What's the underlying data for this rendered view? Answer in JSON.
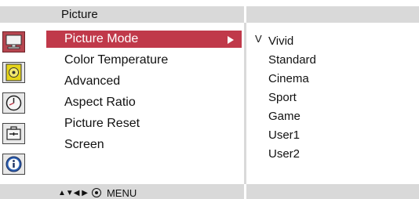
{
  "header": {
    "title": "Picture"
  },
  "sidebar": {
    "icons": [
      {
        "name": "picture-monitor-icon",
        "active": true
      },
      {
        "name": "audio-speaker-icon",
        "active": false
      },
      {
        "name": "time-clock-icon",
        "active": false
      },
      {
        "name": "option-toolbox-icon",
        "active": false
      },
      {
        "name": "information-icon",
        "active": false
      }
    ]
  },
  "menu": {
    "items": [
      {
        "label": "Picture Mode",
        "selected": true,
        "has_submenu_arrow": true
      },
      {
        "label": "Color Temperature"
      },
      {
        "label": "Advanced"
      },
      {
        "label": "Aspect Ratio"
      },
      {
        "label": "Picture Reset"
      },
      {
        "label": "Screen"
      }
    ]
  },
  "options": {
    "check_mark": "V",
    "selected_index": 0,
    "items": [
      "Vivid",
      "Standard",
      "Cinema",
      "Sport",
      "Game",
      "User1",
      "User2"
    ]
  },
  "footer": {
    "nav_glyphs": "▲▼◀ ▶",
    "enter_icon": "enter-circle-icon",
    "menu_label": "MENU"
  },
  "colors": {
    "selection_red": "#c0394a",
    "active_icon_red": "#b6454f",
    "bar_gray": "#d9d9d9"
  }
}
